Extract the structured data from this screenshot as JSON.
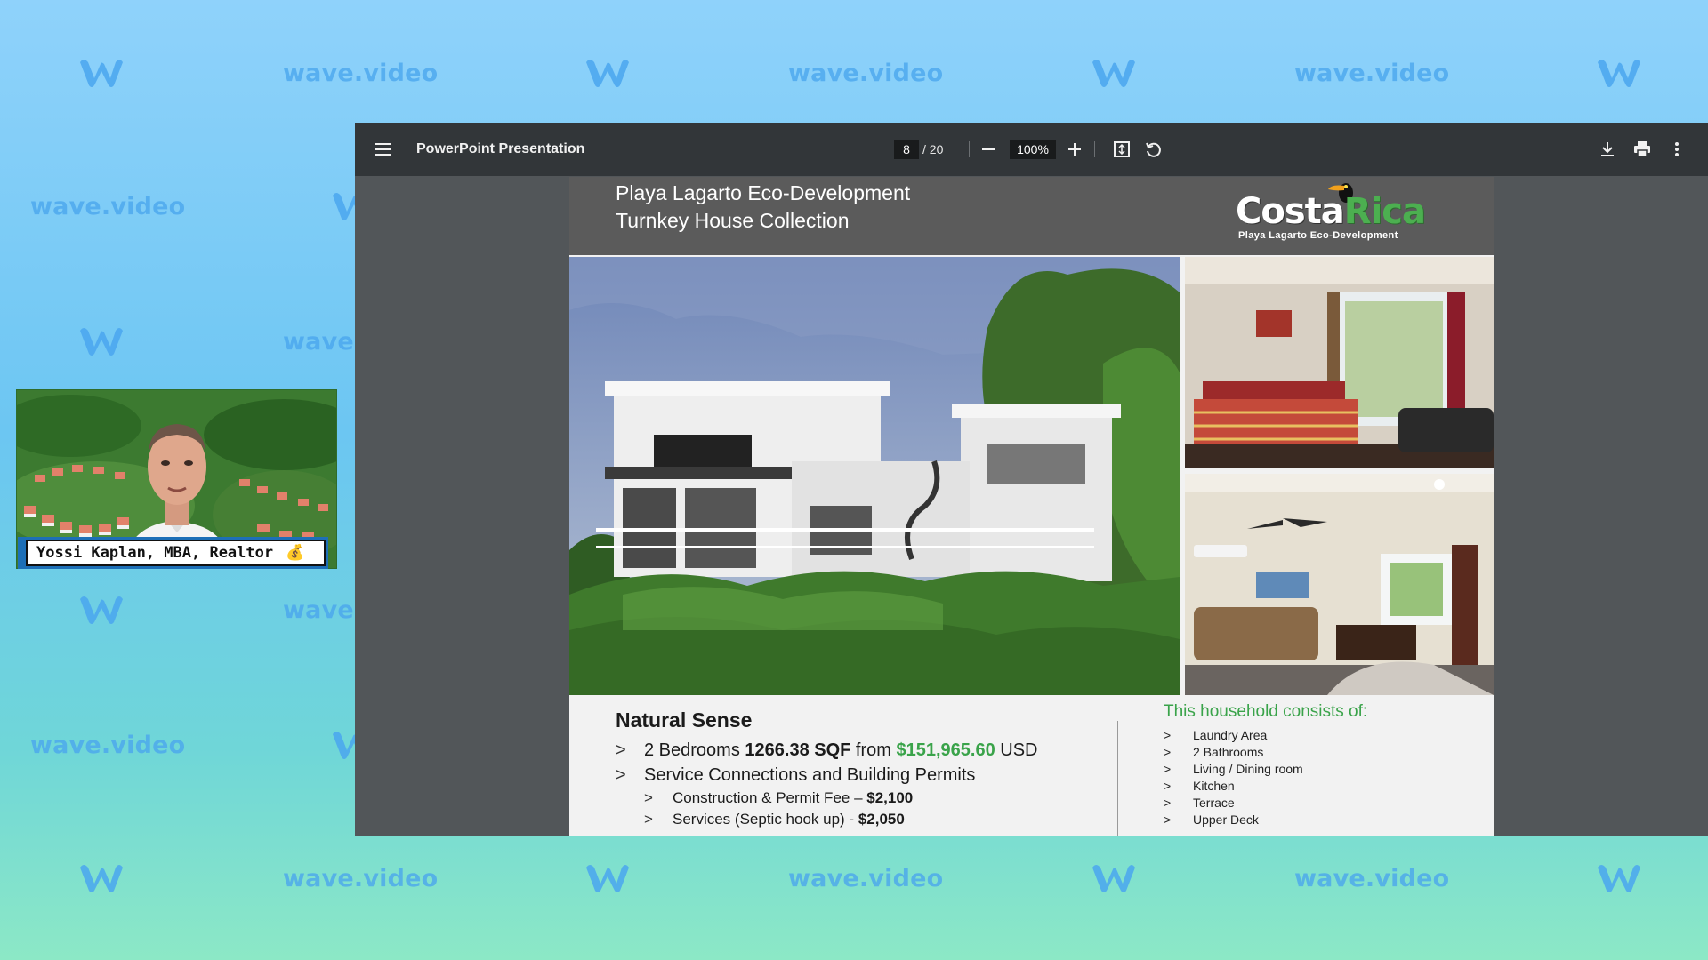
{
  "watermark": {
    "brand_text": "wave.video",
    "logo_icon": "wave-w-logo-icon",
    "color": "#4aa6ee"
  },
  "webcam": {
    "presenter_name": "Yossi Kaplan, MBA, Realtor",
    "name_emoji": "💰"
  },
  "viewer": {
    "menu_icon": "menu-icon",
    "title": "PowerPoint Presentation",
    "page_current": "8",
    "page_total": "/ 20",
    "zoom": "100%",
    "zoom_out_icon": "minus-icon",
    "zoom_in_icon": "plus-icon",
    "fit_icon": "fit-page-icon",
    "rotate_icon": "rotate-icon",
    "download_icon": "download-icon",
    "print_icon": "print-icon",
    "more_icon": "more-vertical-icon"
  },
  "slide": {
    "title_line1": "Playa Lagarto Eco-Development",
    "title_line2": "Turnkey House Collection",
    "logo": {
      "word1": "Costa",
      "word2": "Rica",
      "tagline": "Playa Lagarto Eco-Development"
    },
    "product_name": "Natural Sense",
    "bullet_marker": ">",
    "bullets": {
      "b1_pre": "2 Bedrooms ",
      "b1_sqf": "1266.38 SQF",
      "b1_from": " from ",
      "b1_price": "$151,965.60",
      "b1_currency": " USD",
      "b2": "Service Connections and Building Permits",
      "b3_text": "Construction & Permit Fee – ",
      "b3_price": "$2,100",
      "b4_text": "Services (Septic hook up) - ",
      "b4_price": "$2,050"
    },
    "household": {
      "title": "This household consists of:",
      "items": [
        "Laundry Area",
        "2 Bathrooms",
        "Living / Dining room",
        "Kitchen",
        "Terrace",
        "Upper Deck"
      ]
    }
  },
  "colors": {
    "toolbar": "#323639",
    "viewer_bg": "#525659",
    "slide_header": "#5b5b5b",
    "accent_green": "#3aa34a"
  }
}
